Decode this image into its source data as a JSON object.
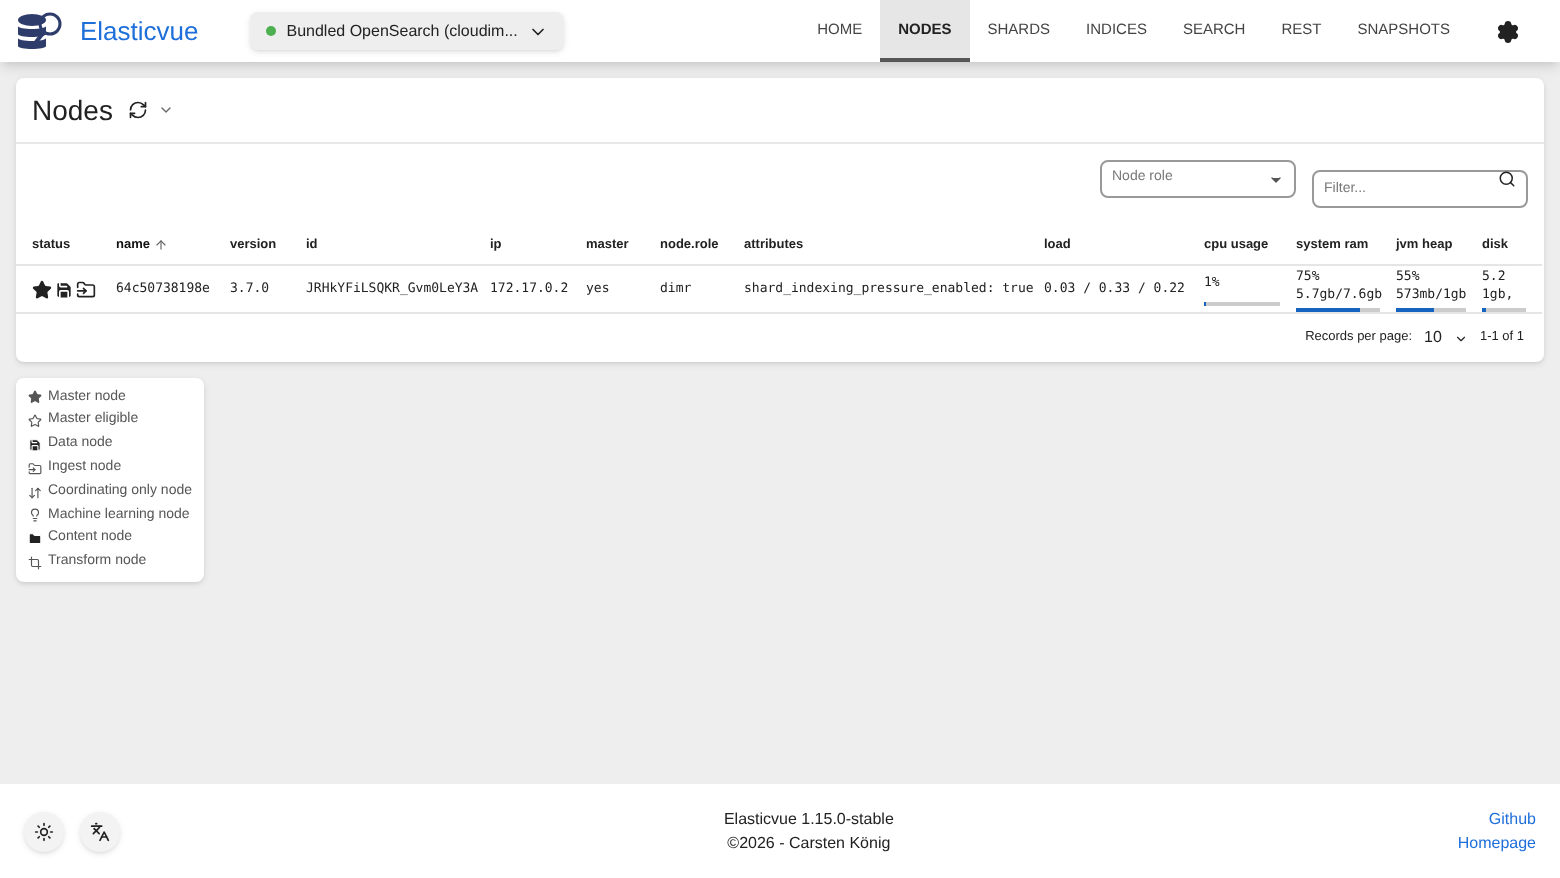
{
  "app": {
    "name": "Elasticvue",
    "cluster": "Bundled OpenSearch (cloudim..."
  },
  "nav": [
    {
      "label": "HOME",
      "selected": false
    },
    {
      "label": "NODES",
      "selected": true
    },
    {
      "label": "SHARDS",
      "selected": false
    },
    {
      "label": "INDICES",
      "selected": false
    },
    {
      "label": "SEARCH",
      "selected": false
    },
    {
      "label": "REST",
      "selected": false
    },
    {
      "label": "SNAPSHOTS",
      "selected": false
    }
  ],
  "page": {
    "title": "Nodes",
    "role_select": {
      "placeholder": "Node role"
    },
    "filter": {
      "placeholder": "Filter..."
    }
  },
  "table": {
    "columns": [
      {
        "label": "status",
        "sorted": false
      },
      {
        "label": "name",
        "sorted": true
      },
      {
        "label": "version",
        "sorted": false
      },
      {
        "label": "id",
        "sorted": false
      },
      {
        "label": "ip",
        "sorted": false
      },
      {
        "label": "master",
        "sorted": false
      },
      {
        "label": "node.role",
        "sorted": false
      },
      {
        "label": "attributes",
        "sorted": false
      },
      {
        "label": "load",
        "sorted": false
      },
      {
        "label": "cpu usage",
        "sorted": false
      },
      {
        "label": "system ram",
        "sorted": false
      },
      {
        "label": "jvm heap",
        "sorted": false
      },
      {
        "label": "disk",
        "sorted": false
      }
    ],
    "rows": [
      {
        "roles": [
          {
            "kind": "master"
          },
          {
            "kind": "data"
          },
          {
            "kind": "ingest"
          }
        ],
        "name": "64c50738198e",
        "version": "3.7.0",
        "id": "JRHkYFiLSQKR_Gvm0LeY3A",
        "ip": "172.17.0.2",
        "master": "yes",
        "node_role": "dimr",
        "attributes": "shard_indexing_pressure_enabled: true",
        "load": "0.03 / 0.33 / 0.22",
        "cpu": {
          "percent": "1%",
          "level": 0.01
        },
        "ram": {
          "percent": "75%",
          "detail": "5.7gb/7.6gb",
          "level": 0.75
        },
        "heap": {
          "percent": "55%",
          "detail": "573mb/1gb",
          "level": 0.55
        },
        "disk": {
          "percent": "5.2",
          "detail": "1gb,",
          "level": 0.1
        }
      }
    ]
  },
  "pagination": {
    "label": "Records per page:",
    "per_page": "10",
    "range": "1-1 of 1"
  },
  "legend": [
    {
      "kind": "master",
      "label": "Master node"
    },
    {
      "kind": "eligible",
      "label": "Master eligible"
    },
    {
      "kind": "data",
      "label": "Data node"
    },
    {
      "kind": "ingest",
      "label": "Ingest node"
    },
    {
      "kind": "coordinating",
      "label": "Coordinating only node"
    },
    {
      "kind": "ml",
      "label": "Machine learning node"
    },
    {
      "kind": "content",
      "label": "Content node"
    },
    {
      "kind": "transform",
      "label": "Transform node"
    }
  ],
  "footer": {
    "version": "Elasticvue 1.15.0-stable",
    "copyright": "©2026 - Carsten König",
    "links": [
      "Github",
      "Homepage"
    ]
  }
}
